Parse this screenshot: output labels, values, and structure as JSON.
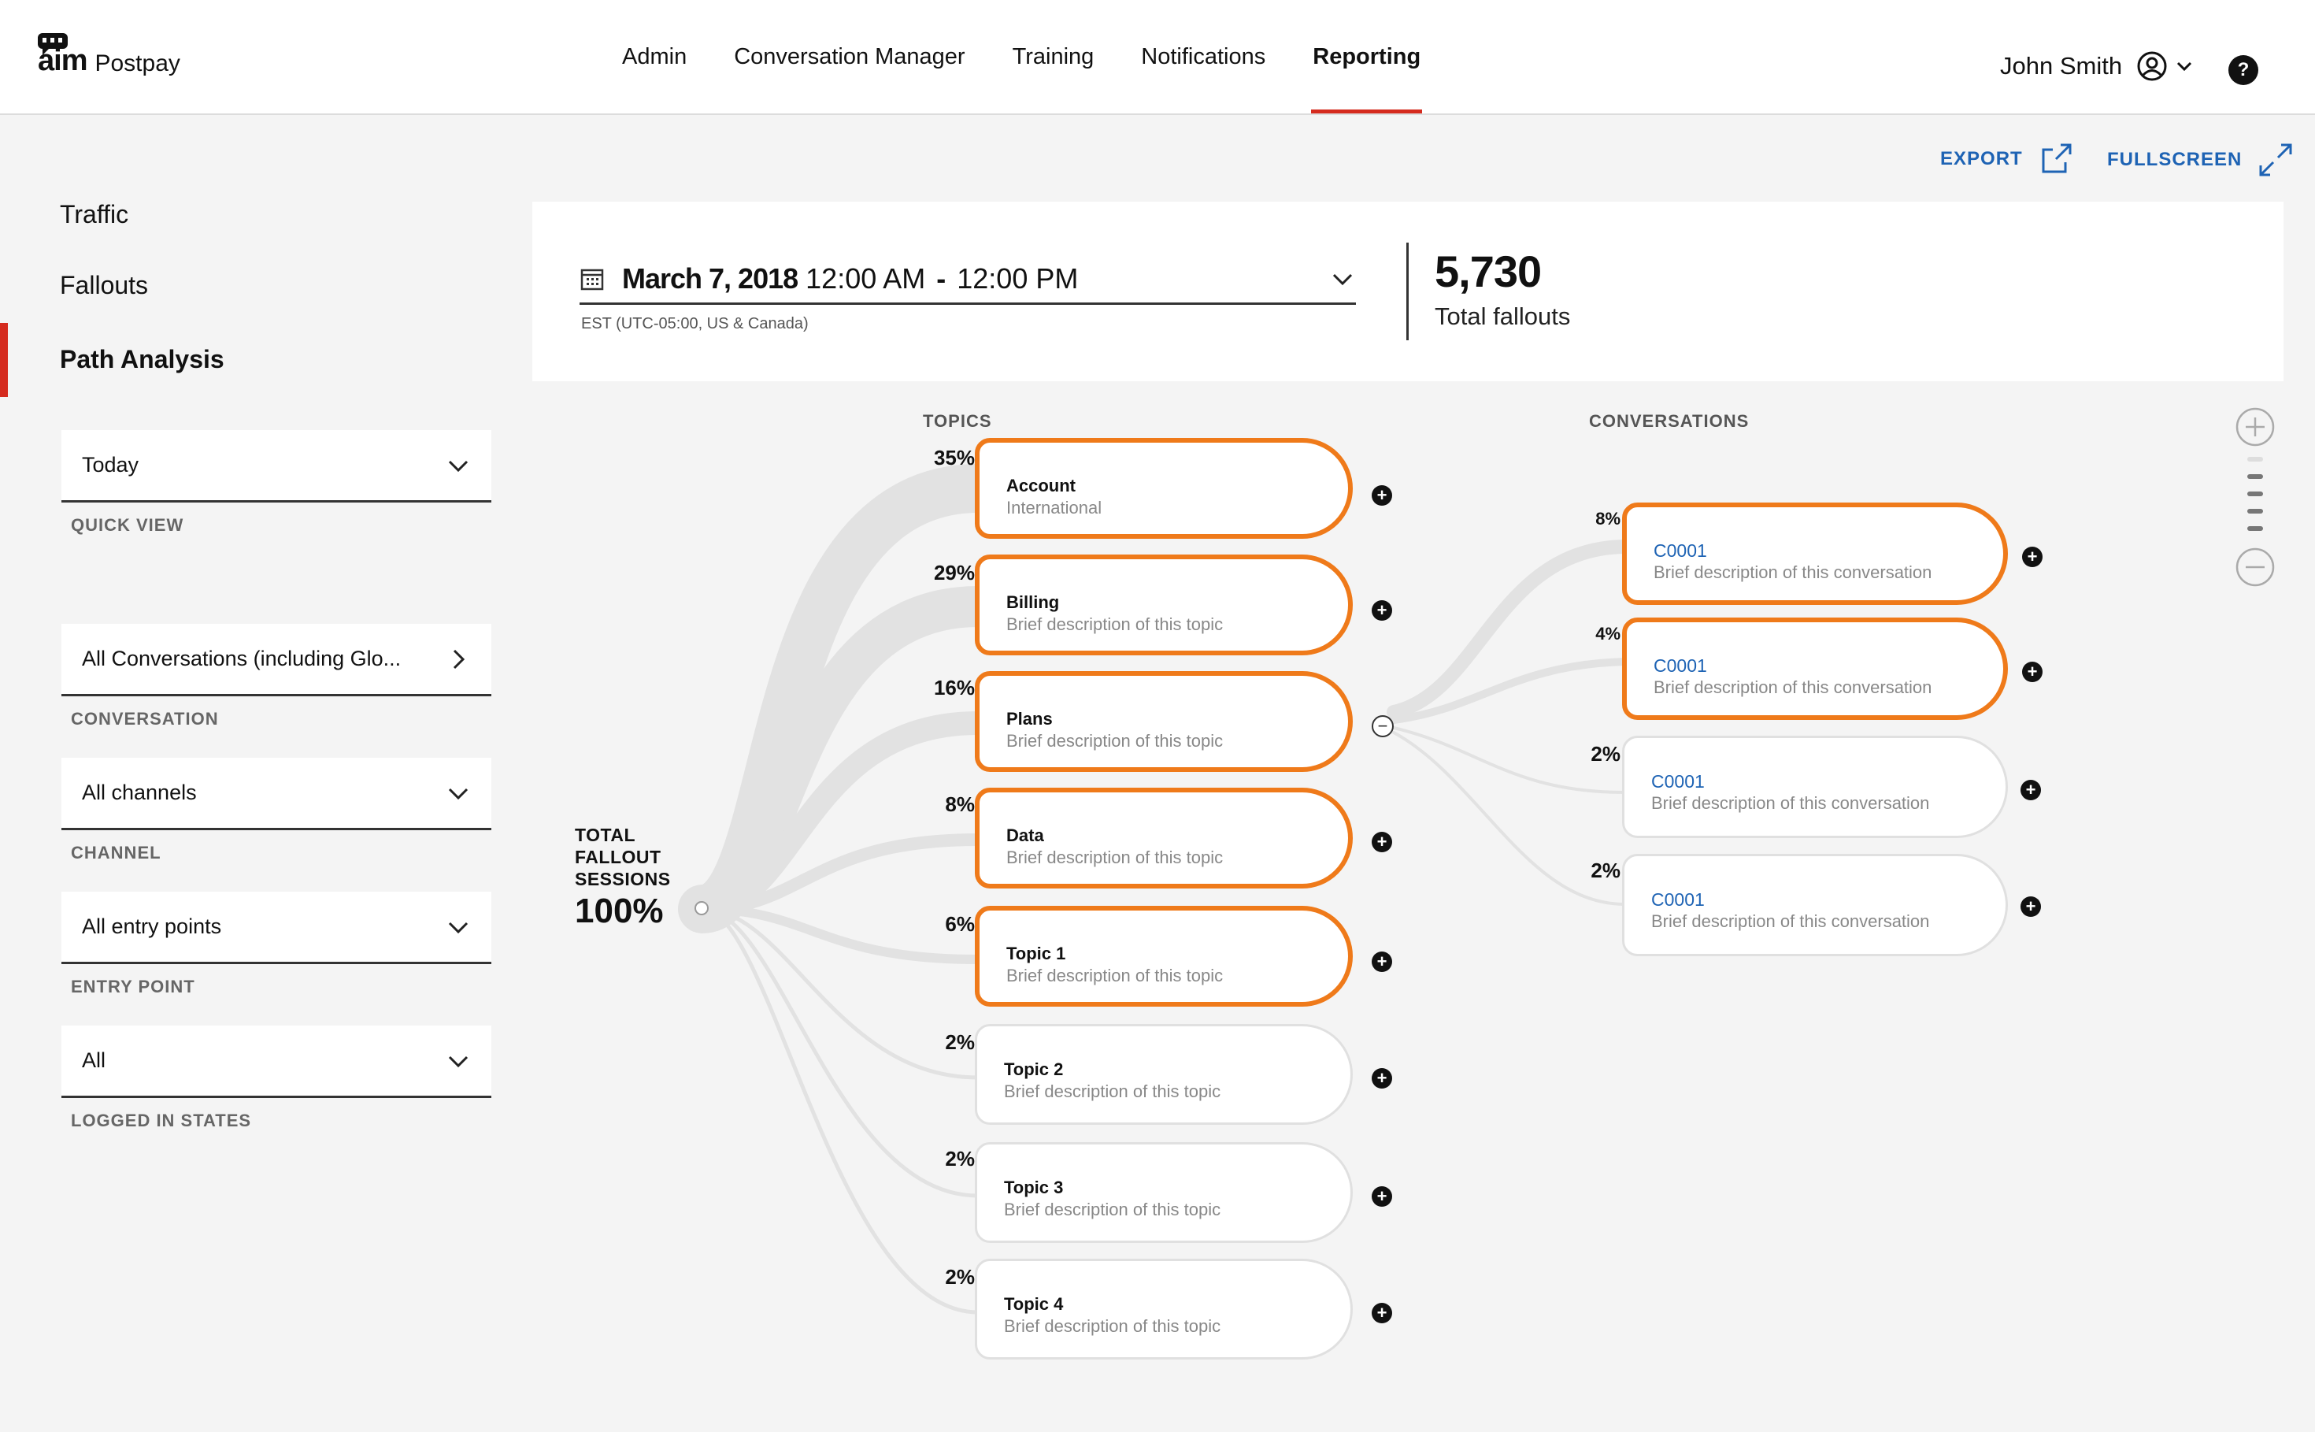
{
  "header": {
    "logo_mark": "aim",
    "logo_text": "Postpay",
    "nav": [
      "Admin",
      "Conversation Manager",
      "Training",
      "Notifications",
      "Reporting"
    ],
    "active_nav": "Reporting",
    "user_name": "John Smith",
    "help": "?"
  },
  "sidebar": {
    "links": [
      "Traffic",
      "Fallouts",
      "Path Analysis"
    ],
    "active": "Path Analysis",
    "filters": [
      {
        "value": "Today",
        "caption": "QUICK VIEW",
        "control": "dropdown"
      },
      {
        "value": "All Conversations (including Glo...",
        "caption": "CONVERSATION",
        "control": "arrow"
      },
      {
        "value": "All channels",
        "caption": "CHANNEL",
        "control": "dropdown"
      },
      {
        "value": "All entry points",
        "caption": "ENTRY POINT",
        "control": "dropdown"
      },
      {
        "value": "All",
        "caption": "LOGGED IN STATES",
        "control": "dropdown"
      }
    ]
  },
  "actions": {
    "export": "EXPORT",
    "fullscreen": "FULLSCREEN"
  },
  "date": {
    "day": "March 7, 2018",
    "start": "12:00 AM",
    "sep": "-",
    "end": "12:00 PM",
    "timezone": "EST (UTC-05:00, US & Canada)"
  },
  "totals": {
    "value": "5,730",
    "label": "Total fallouts"
  },
  "graph": {
    "topics_title": "TOPICS",
    "conversations_title": "CONVERSATIONS",
    "root": {
      "label_lines": [
        "TOTAL",
        "FALLOUT",
        "SESSIONS"
      ],
      "pct": "100%"
    },
    "topics": [
      {
        "pct": "35%",
        "title": "Account",
        "desc": "International",
        "highlight": true,
        "expanded": false
      },
      {
        "pct": "29%",
        "title": "Billing",
        "desc": "Brief description of this topic",
        "highlight": true,
        "expanded": false
      },
      {
        "pct": "16%",
        "title": "Plans",
        "desc": "Brief description of this topic",
        "highlight": true,
        "expanded": true
      },
      {
        "pct": "8%",
        "title": "Data",
        "desc": "Brief description of this topic",
        "highlight": true,
        "expanded": false
      },
      {
        "pct": "6%",
        "title": "Topic 1",
        "desc": "Brief description of this topic",
        "highlight": true,
        "expanded": false
      },
      {
        "pct": "2%",
        "title": "Topic 2",
        "desc": "Brief description of this topic",
        "highlight": false,
        "expanded": false
      },
      {
        "pct": "2%",
        "title": "Topic 3",
        "desc": "Brief description of this topic",
        "highlight": false,
        "expanded": false
      },
      {
        "pct": "2%",
        "title": "Topic 4",
        "desc": "Brief description of this topic",
        "highlight": false,
        "expanded": false
      }
    ],
    "conversations": [
      {
        "pct": "8%",
        "title": "C0001",
        "desc": "Brief description of this conversation",
        "highlight": true
      },
      {
        "pct": "4%",
        "title": "C0001",
        "desc": "Brief description of this conversation",
        "highlight": true
      },
      {
        "pct": "2%",
        "title": "C0001",
        "desc": "Brief description of this conversation",
        "highlight": false
      },
      {
        "pct": "2%",
        "title": "C0001",
        "desc": "Brief description of this conversation",
        "highlight": false
      }
    ]
  },
  "colors": {
    "accent": "#d52b1e",
    "highlight": "#ef7a1a",
    "link": "#1e63b4",
    "flow": "#e2e2e2"
  },
  "icons": [
    "calendar-icon",
    "chevron-down-icon",
    "chevron-right-icon",
    "export-icon",
    "fullscreen-icon",
    "user-icon",
    "help-icon",
    "plus-icon",
    "minus-icon",
    "zoom-in-icon",
    "zoom-out-icon"
  ]
}
